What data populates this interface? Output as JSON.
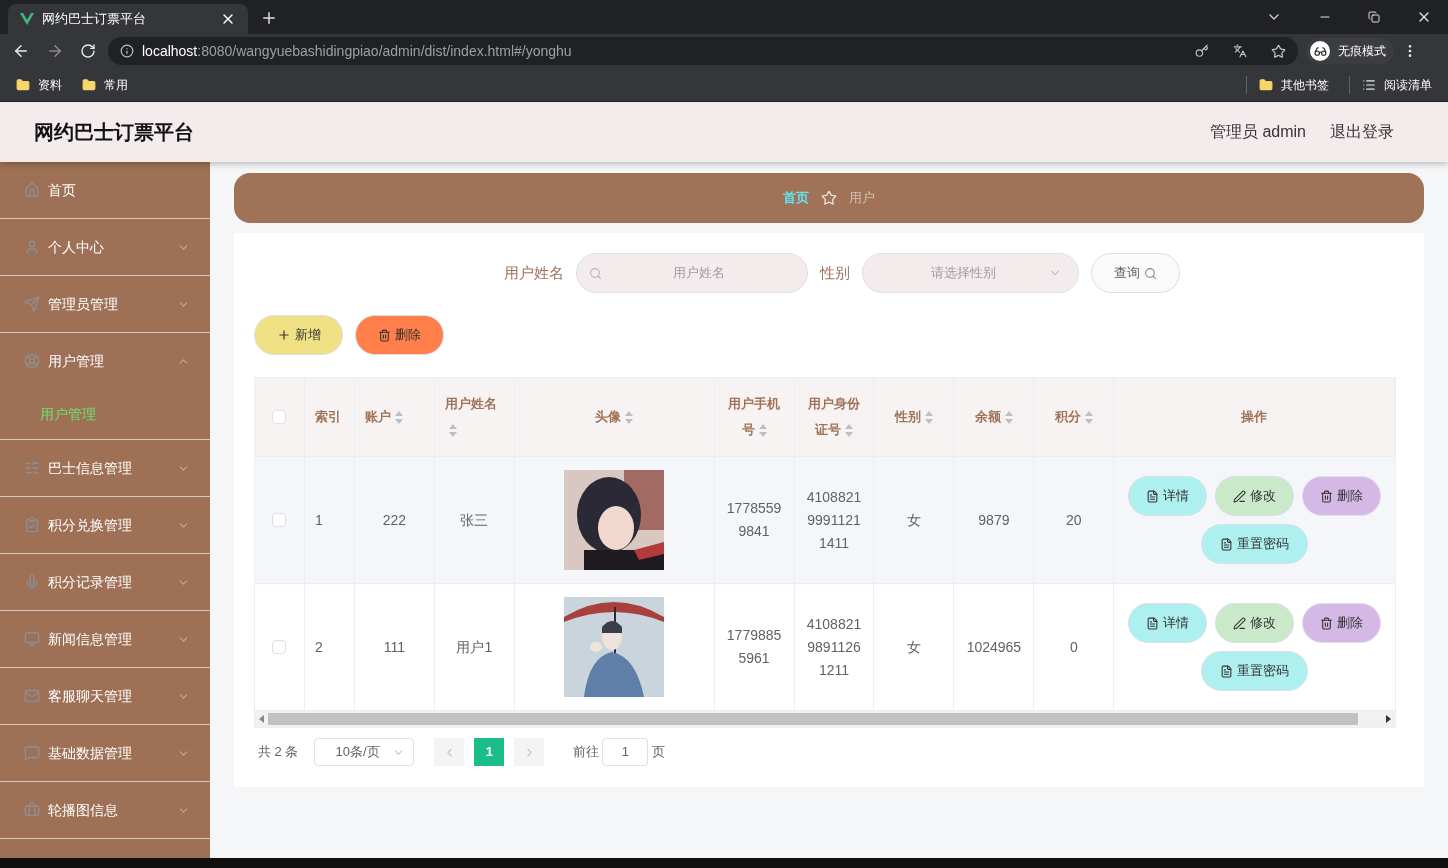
{
  "browser": {
    "tab_title": "网约巴士订票平台",
    "url_host": "localhost",
    "url_rest": ":8080/wangyuebashidingpiao/admin/dist/index.html#/yonghu",
    "incognito_label": "无痕模式",
    "bookmarks": [
      "资料",
      "常用"
    ],
    "bookmarks_right": [
      {
        "label": "其他书签",
        "kind": "folder"
      },
      {
        "label": "阅读清单",
        "kind": "list"
      }
    ]
  },
  "header": {
    "title": "网约巴士订票平台",
    "user": "管理员 admin",
    "logout": "退出登录"
  },
  "sidebar": {
    "items": [
      {
        "label": "首页",
        "kind": "link"
      },
      {
        "label": "个人中心",
        "kind": "menu",
        "expanded": false
      },
      {
        "label": "管理员管理",
        "kind": "menu",
        "expanded": false
      },
      {
        "label": "用户管理",
        "kind": "menu",
        "expanded": true,
        "children": [
          {
            "label": "用户管理",
            "selected": true
          }
        ]
      },
      {
        "label": "巴士信息管理",
        "kind": "menu",
        "expanded": false
      },
      {
        "label": "积分兑换管理",
        "kind": "menu",
        "expanded": false
      },
      {
        "label": "积分记录管理",
        "kind": "menu",
        "expanded": false
      },
      {
        "label": "新闻信息管理",
        "kind": "menu",
        "expanded": false
      },
      {
        "label": "客服聊天管理",
        "kind": "menu",
        "expanded": false
      },
      {
        "label": "基础数据管理",
        "kind": "menu",
        "expanded": false
      },
      {
        "label": "轮播图信息",
        "kind": "menu",
        "expanded": false
      }
    ]
  },
  "breadcrumb": [
    {
      "label": "首页",
      "selected": true
    },
    {
      "label": "用户",
      "selected": false
    }
  ],
  "search": {
    "name_label": "用户姓名",
    "name_placeholder": "用户姓名",
    "gender_label": "性别",
    "gender_placeholder": "请选择性别",
    "query_button": "查询"
  },
  "actions": {
    "add": "新增",
    "delete": "删除"
  },
  "table": {
    "select_all_checked": false,
    "columns": [
      {
        "label": "索引",
        "sortable": false
      },
      {
        "label": "账户",
        "sortable": true
      },
      {
        "label": "用户姓名",
        "sortable": true
      },
      {
        "label": "头像",
        "sortable": true
      },
      {
        "label": "用户手机号",
        "sortable": true
      },
      {
        "label": "用户身份证号",
        "sortable": true
      },
      {
        "label": "性别",
        "sortable": true
      },
      {
        "label": "余额",
        "sortable": true
      },
      {
        "label": "积分",
        "sortable": true
      },
      {
        "label": "操作",
        "sortable": false
      }
    ],
    "rows": [
      {
        "checked": false,
        "index": "1",
        "account": "222",
        "name": "张三",
        "phone": "17785599841",
        "id_card": "410882199911211411",
        "gender": "女",
        "balance": "9879",
        "points": "20",
        "buttons": [
          "详情",
          "修改",
          "删除",
          "重置密码"
        ]
      },
      {
        "checked": false,
        "index": "2",
        "account": "111",
        "name": "用户1",
        "phone": "17798855961",
        "id_card": "410882198911261211",
        "gender": "女",
        "balance": "1024965",
        "points": "0",
        "buttons": [
          "详情",
          "修改",
          "删除",
          "重置密码"
        ]
      }
    ]
  },
  "pagination": {
    "total": "共 2 条",
    "page_size": "10条/页",
    "pages": [
      {
        "label": "1",
        "selected": true
      }
    ],
    "goto_prefix": "前往",
    "goto_value": "1",
    "goto_suffix": "页"
  }
}
